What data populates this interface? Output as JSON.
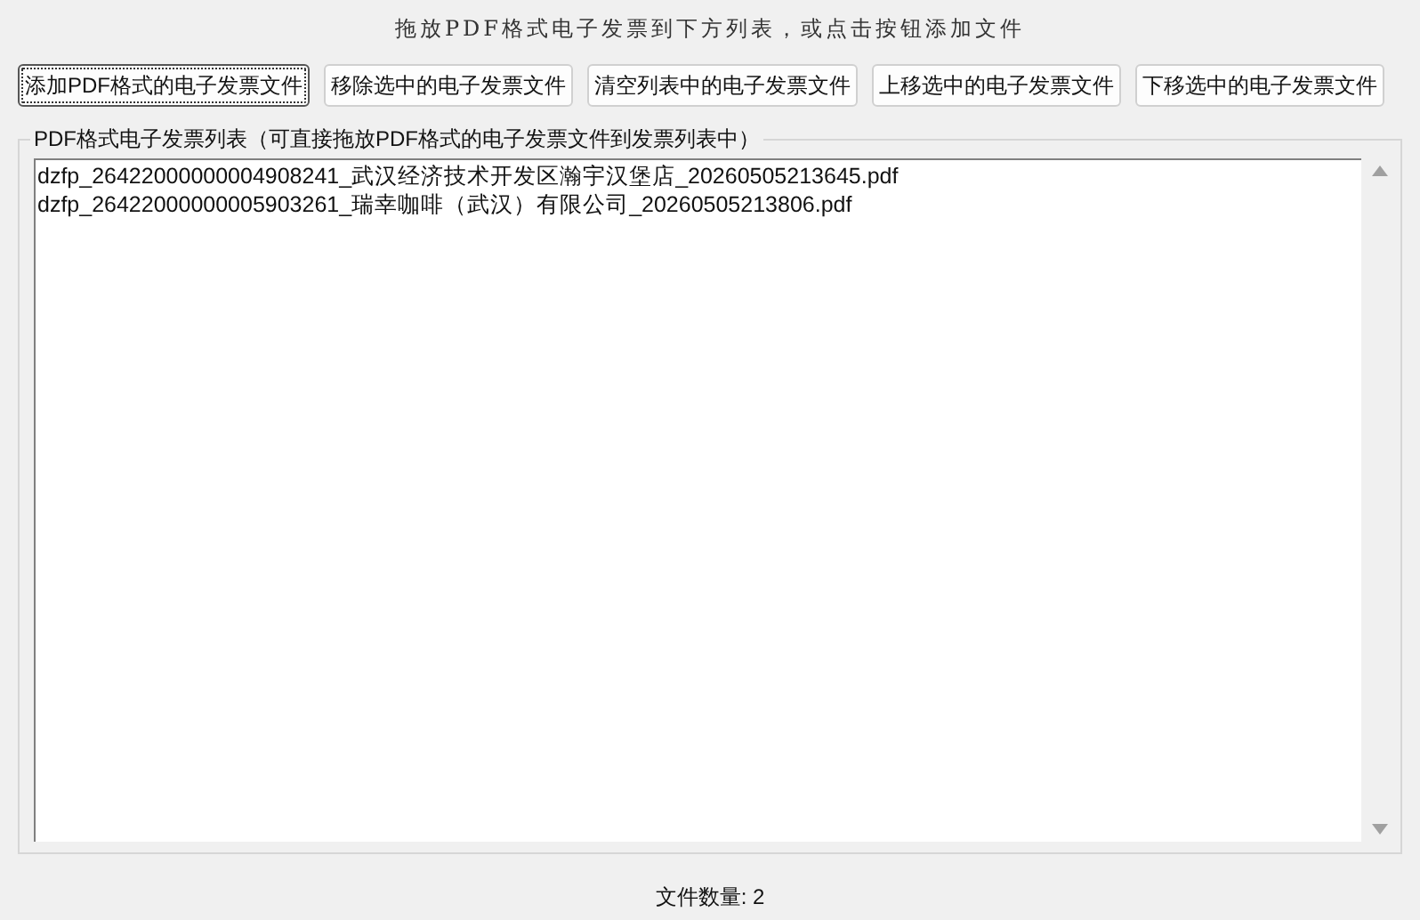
{
  "hint": "拖放PDF格式电子发票到下方列表，或点击按钮添加文件",
  "buttons": [
    {
      "label": "添加PDF格式的电子发票文件",
      "focused": true
    },
    {
      "label": "移除选中的电子发票文件",
      "focused": false
    },
    {
      "label": "清空列表中的电子发票文件",
      "focused": false
    },
    {
      "label": "上移选中的电子发票文件",
      "focused": false
    },
    {
      "label": "下移选中的电子发票文件",
      "focused": false
    }
  ],
  "group": {
    "title": "PDF格式电子发票列表（可直接拖放PDF格式的电子发票文件到发票列表中）",
    "files": [
      {
        "name": "dzfp_26422000000004908241_武汉经济技术开发区瀚宇汉堡店_20260505213645.pdf",
        "selected": false
      },
      {
        "name": "dzfp_26422000000005903261_瑞幸咖啡（武汉）有限公司_20260505213806.pdf",
        "selected": false
      }
    ]
  },
  "status_bar": "文件数量: 2"
}
